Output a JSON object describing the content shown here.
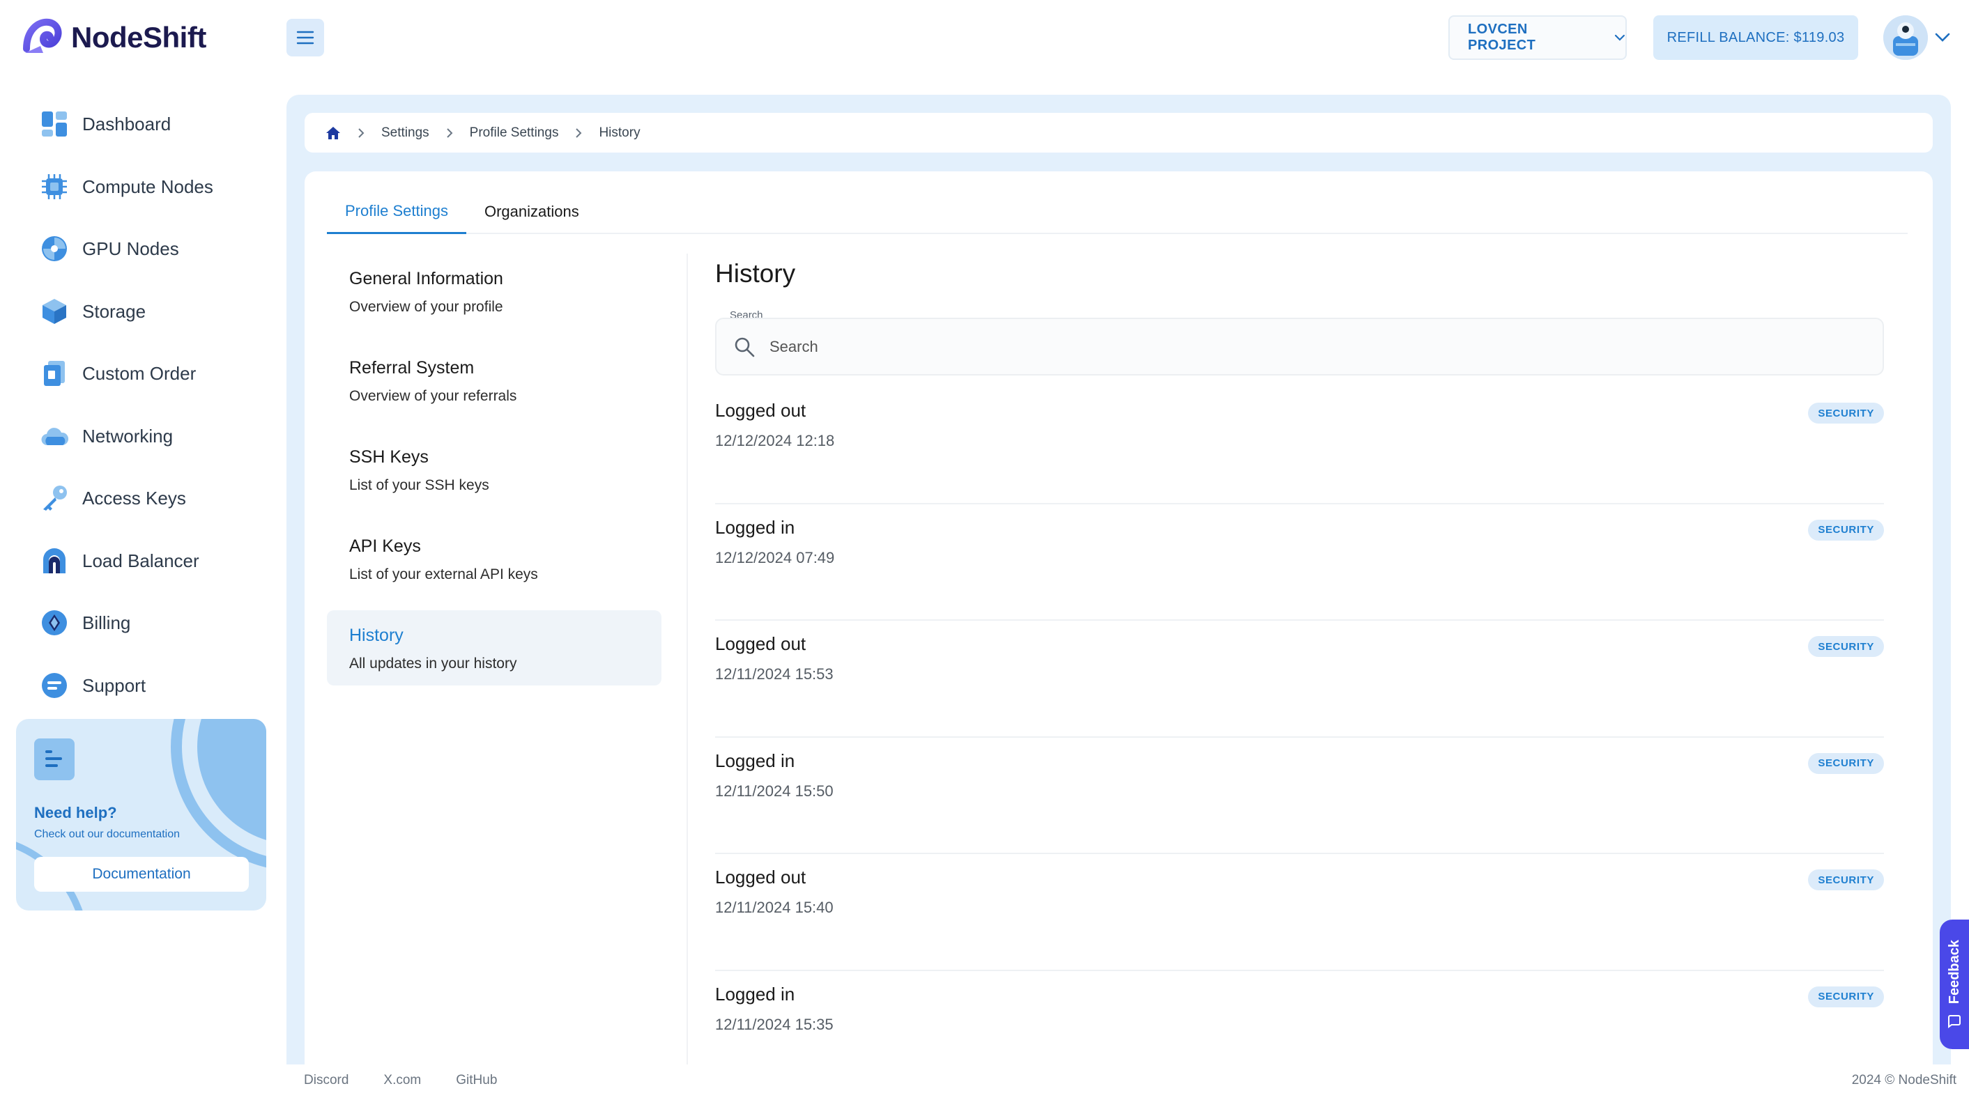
{
  "brand": {
    "name": "NodeShift"
  },
  "topbar": {
    "project_label": "LOVCEN PROJECT",
    "refill_label": "REFILL BALANCE:",
    "balance": "$119.03"
  },
  "sidebar": {
    "items": [
      {
        "label": "Dashboard",
        "icon": "dashboard-icon"
      },
      {
        "label": "Compute Nodes",
        "icon": "chip-icon"
      },
      {
        "label": "GPU Nodes",
        "icon": "gpu-icon"
      },
      {
        "label": "Storage",
        "icon": "cube-icon"
      },
      {
        "label": "Custom Order",
        "icon": "document-icon"
      },
      {
        "label": "Networking",
        "icon": "cloud-icon"
      },
      {
        "label": "Access Keys",
        "icon": "key-icon"
      },
      {
        "label": "Load Balancer",
        "icon": "balancer-icon"
      },
      {
        "label": "Billing",
        "icon": "diamond-icon"
      },
      {
        "label": "Support",
        "icon": "chat-icon"
      }
    ],
    "help": {
      "title": "Need help?",
      "subtitle": "Check out our documentation",
      "button": "Documentation"
    }
  },
  "breadcrumb": [
    "Settings",
    "Profile Settings",
    "History"
  ],
  "tabs": [
    {
      "label": "Profile Settings",
      "active": true
    },
    {
      "label": "Organizations",
      "active": false
    }
  ],
  "settings_menu": [
    {
      "title": "General Information",
      "desc": "Overview of your profile"
    },
    {
      "title": "Referral System",
      "desc": "Overview of your referrals"
    },
    {
      "title": "SSH Keys",
      "desc": "List of your SSH keys"
    },
    {
      "title": "API Keys",
      "desc": "List of your external API keys"
    },
    {
      "title": "History",
      "desc": "All updates in your history",
      "active": true
    }
  ],
  "history": {
    "title": "History",
    "search_label": "Search",
    "search_placeholder": "Search",
    "entries": [
      {
        "event": "Logged out",
        "time": "12/12/2024 12:18",
        "tag": "SECURITY"
      },
      {
        "event": "Logged in",
        "time": "12/12/2024 07:49",
        "tag": "SECURITY"
      },
      {
        "event": "Logged out",
        "time": "12/11/2024 15:53",
        "tag": "SECURITY"
      },
      {
        "event": "Logged in",
        "time": "12/11/2024 15:50",
        "tag": "SECURITY"
      },
      {
        "event": "Logged out",
        "time": "12/11/2024 15:40",
        "tag": "SECURITY"
      },
      {
        "event": "Logged in",
        "time": "12/11/2024 15:35",
        "tag": "SECURITY"
      }
    ]
  },
  "footer": {
    "links": [
      "Discord",
      "X.com",
      "GitHub"
    ],
    "copyright": "2024 © NodeShift"
  },
  "feedback": {
    "label": "Feedback"
  },
  "colors": {
    "accent": "#1e7fd0",
    "brand_dark": "#1c1a4f",
    "panel_bg": "#e3f0fc",
    "feedback": "#4a48e8"
  }
}
